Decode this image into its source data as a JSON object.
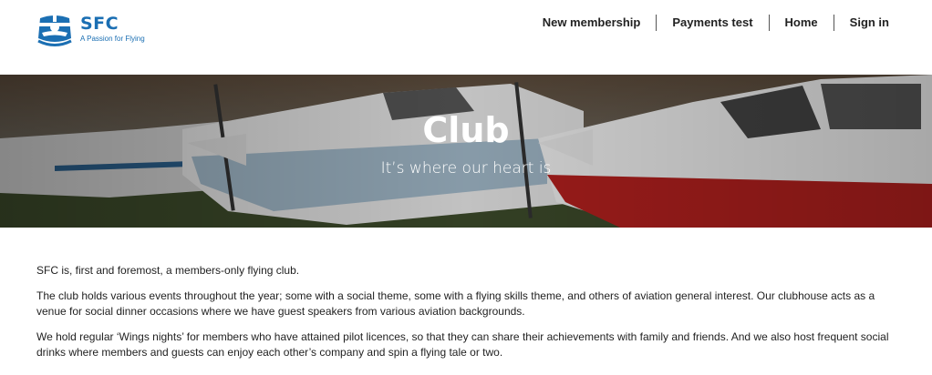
{
  "logo": {
    "title": "SFC",
    "tagline": "A Passion for Flying"
  },
  "nav": {
    "items": [
      {
        "label": "New membership"
      },
      {
        "label": "Payments test"
      },
      {
        "label": "Home"
      },
      {
        "label": "Sign in"
      }
    ]
  },
  "hero": {
    "title": "Club",
    "subtitle": "It’s where our heart is"
  },
  "content": {
    "paragraphs": [
      "SFC is, first and foremost, a members-only flying club.",
      "The club holds various events throughout the year; some with a social theme, some with a flying skills theme, and others of aviation general interest.  Our clubhouse acts as a venue for social dinner occasions where we have guest speakers from various aviation backgrounds.",
      "We hold regular ‘Wings nights’ for members who have attained pilot licences, so that they can share their achievements with family and friends. And we also host frequent social drinks where members and guests can enjoy each other’s company and spin a flying tale or two."
    ]
  },
  "colors": {
    "brand": "#1b6fb3",
    "accent_red": "#b3201e"
  }
}
